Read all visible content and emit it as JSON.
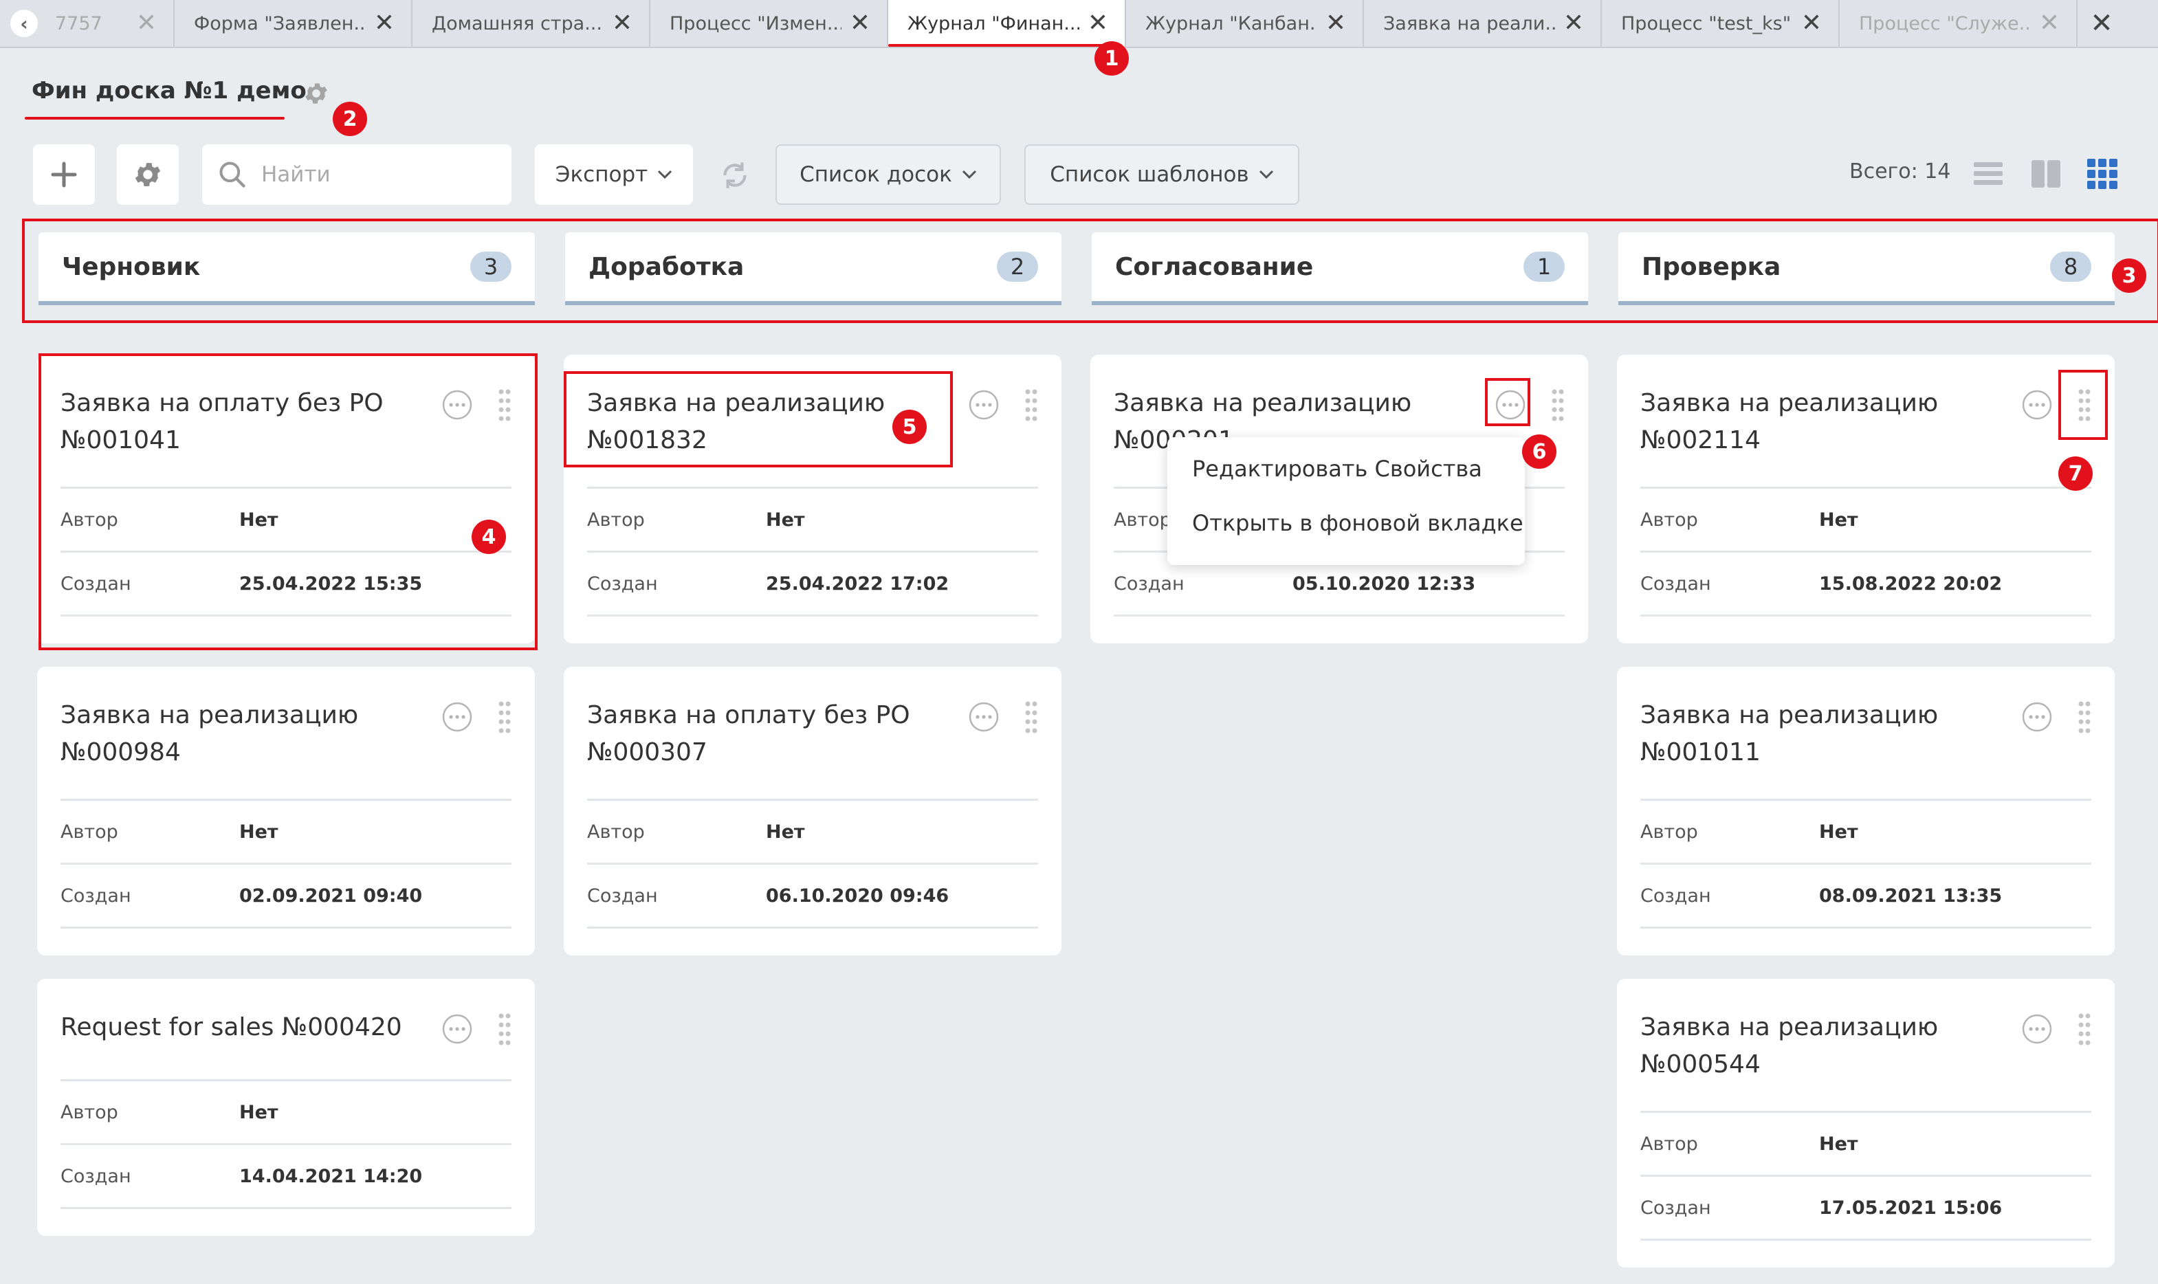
{
  "tabs": [
    {
      "label": "7757",
      "dim": true
    },
    {
      "label": "Форма \"Заявлен...",
      "dim": false
    },
    {
      "label": "Домашняя стра...",
      "dim": false
    },
    {
      "label": "Процесс \"Измен...",
      "dim": false
    },
    {
      "label": "Журнал \"Финан...",
      "active": true
    },
    {
      "label": "Журнал \"Канбан...",
      "dim": false
    },
    {
      "label": "Заявка на реали...",
      "dim": false
    },
    {
      "label": "Процесс \"test_ks\"",
      "dim": false
    },
    {
      "label": "Процесс \"Служе...",
      "dim": true
    }
  ],
  "page": {
    "title": "Фин доска №1 демо"
  },
  "toolbar": {
    "add_icon": "plus-icon",
    "settings_icon": "gear-icon",
    "search_placeholder": "Найти",
    "export_label": "Экспорт",
    "boards_label": "Список досок",
    "templates_label": "Список шаблонов",
    "total_label": "Всего: 14"
  },
  "columns": [
    {
      "title": "Черновик",
      "count": "3",
      "cards": [
        {
          "title": "Заявка на оплату без РО №001041",
          "author_label": "Автор",
          "author": "Нет",
          "created_label": "Создан",
          "created": "25.04.2022 15:35"
        },
        {
          "title": "Заявка на реализацию №000984",
          "author_label": "Автор",
          "author": "Нет",
          "created_label": "Создан",
          "created": "02.09.2021 09:40"
        },
        {
          "title": "Request for sales №000420",
          "author_label": "Автор",
          "author": "Нет",
          "created_label": "Создан",
          "created": "14.04.2021 14:20"
        }
      ]
    },
    {
      "title": "Доработка",
      "count": "2",
      "cards": [
        {
          "title": "Заявка на реализацию №001832",
          "author_label": "Автор",
          "author": "Нет",
          "created_label": "Создан",
          "created": "25.04.2022 17:02"
        },
        {
          "title": "Заявка на оплату без РО №000307",
          "author_label": "Автор",
          "author": "Нет",
          "created_label": "Создан",
          "created": "06.10.2020 09:46"
        }
      ]
    },
    {
      "title": "Согласование",
      "count": "1",
      "cards": [
        {
          "title": "Заявка на реализацию №000201",
          "author_label": "Автор",
          "author": "",
          "created_label": "Создан",
          "created": "05.10.2020 12:33"
        }
      ]
    },
    {
      "title": "Проверка",
      "count": "8",
      "cards": [
        {
          "title": "Заявка на реализацию №002114",
          "author_label": "Автор",
          "author": "Нет",
          "created_label": "Создан",
          "created": "15.08.2022 20:02"
        },
        {
          "title": "Заявка на реализацию №001011",
          "author_label": "Автор",
          "author": "Нет",
          "created_label": "Создан",
          "created": "08.09.2021 13:35"
        },
        {
          "title": "Заявка на реализацию №000544",
          "author_label": "Автор",
          "author": "Нет",
          "created_label": "Создан",
          "created": "17.05.2021 15:06"
        }
      ]
    }
  ],
  "context_menu": {
    "items": [
      "Редактировать Свойства",
      "Открыть в фоновой вкладке"
    ]
  },
  "annotations": [
    "1",
    "2",
    "3",
    "4",
    "5",
    "6",
    "7"
  ],
  "colors": {
    "accent": "#e3111b",
    "column_underline": "#9bb2cb",
    "count_badge": "#c7d6e6",
    "view_active": "#2f6fc6"
  }
}
